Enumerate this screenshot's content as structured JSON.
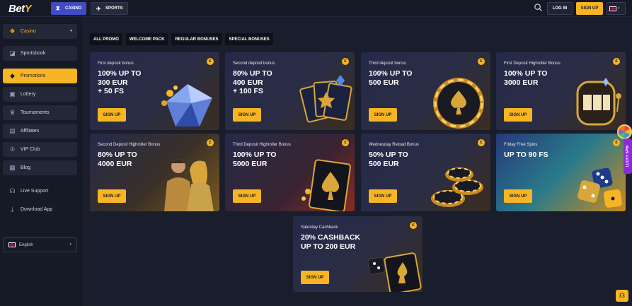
{
  "header": {
    "logo_text": "Bet",
    "logo_accent": "Y",
    "nav": [
      {
        "label": "CASINO",
        "icon": "casino-icon"
      },
      {
        "label": "SPORTS",
        "icon": "sports-icon"
      }
    ],
    "login_label": "LOG IN",
    "signup_label": "SIGN UP",
    "language_flag": "uk-flag-icon"
  },
  "sidebar": {
    "casino_label": "Casino",
    "items": [
      {
        "label": "Sportsbook",
        "icon": "sportsbook-icon"
      },
      {
        "label": "Promotions",
        "icon": "diamond-icon"
      },
      {
        "label": "Lottery",
        "icon": "lottery-icon"
      },
      {
        "label": "Tournaments",
        "icon": "trophy-icon"
      },
      {
        "label": "Affiliates",
        "icon": "affiliates-icon"
      },
      {
        "label": "VIP Club",
        "icon": "crown-icon"
      },
      {
        "label": "Blog",
        "icon": "blog-icon"
      },
      {
        "label": "Live Support",
        "icon": "headset-icon"
      },
      {
        "label": "Download App",
        "icon": "download-icon"
      }
    ],
    "language": "English"
  },
  "filters": [
    "ALL PROMO",
    "WELCOME PACK",
    "REGULAR BONUSES",
    "SPECIAL BONUSES"
  ],
  "promos": [
    {
      "subtitle": "First deposit bonus",
      "headline": "100% UP TO\n300 EUR\n+ 50 FS",
      "cta": "SIGN UP"
    },
    {
      "subtitle": "Second deposit bonus",
      "headline": "80% UP TO\n400 EUR\n+ 100 FS",
      "cta": "SIGN UP"
    },
    {
      "subtitle": "Third deposit bonus",
      "headline": "100% UP TO\n500 EUR",
      "cta": "SIGN UP"
    },
    {
      "subtitle": "First Deposit Highroller Bonus",
      "headline": "100% UP TO\n3000 EUR",
      "cta": "SIGN UP"
    },
    {
      "subtitle": "Second Deposit Highroller Bonus",
      "headline": "80% UP TO\n4000 EUR",
      "cta": "SIGN UP"
    },
    {
      "subtitle": "Third Deposit Highroller Bonus",
      "headline": "100% UP TO\n5000 EUR",
      "cta": "SIGN UP"
    },
    {
      "subtitle": "Wednesday Reload Bonus",
      "headline": "50% UP TO\n500 EUR",
      "cta": "SIGN UP"
    },
    {
      "subtitle": "Friday Free Spins",
      "headline": "UP TO 90 FS",
      "cta": "SIGN UP"
    },
    {
      "subtitle": "Saturday Cashback",
      "headline": "20% CASHBACK\nUP TO 200 EUR",
      "cta": "SIGN UP"
    }
  ],
  "badge_symbol": "£",
  "lucky_spin_label": "LUCKY SPIN",
  "colors": {
    "accent": "#f7b523",
    "nav_active": "#3f4cc4",
    "background": "#1a1d2b"
  }
}
